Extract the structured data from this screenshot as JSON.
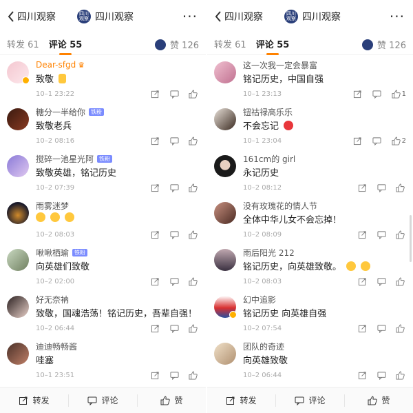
{
  "colors": {
    "accent": "#ff8200",
    "fan_badge": "#7b8cff",
    "meta_gray": "#aaaaaa",
    "emoji_yellow": "#ffc83d",
    "flower_red": "#e8363b"
  },
  "left": {
    "header": {
      "back_label": "四川观察",
      "account_name": "四川观察",
      "logo_text": "四川观察",
      "more_label": "···"
    },
    "tabs": {
      "repost": "转发 61",
      "comment": "评论 55",
      "like": "赞 126"
    },
    "comments": [
      {
        "user": "Dear-sfgd",
        "highlight": true,
        "crown": "♛",
        "text": "致敬",
        "emoji": "thumbs-up",
        "time": "10–1 23:22"
      },
      {
        "user": "糖分一半给你",
        "fan_badge": "铁粉",
        "text": "致敬老兵",
        "time": "10–2 08:16"
      },
      {
        "user": "搅碎一池星光阿",
        "fan_badge": "铁粉",
        "text": "致敬英雄，铭记历史",
        "time": "10–2 07:39"
      },
      {
        "user": "雨雾迷梦",
        "text": "",
        "emoji": "three-faces",
        "time": "10–2 08:03"
      },
      {
        "user": "啾啾栖瑜",
        "fan_badge": "铁粉",
        "text": "向英雄们致敬",
        "time": "10–2 02:00"
      },
      {
        "user": "好无奈衲",
        "text": "致敬，国魂浩荡！铭记历史，吾辈自强！",
        "time": "10–2 06:44"
      },
      {
        "user": "迪迪畅畅酱",
        "text": "哇塞",
        "time": "10–1 23:51"
      }
    ],
    "bottom": {
      "repost": "转发",
      "comment": "评论",
      "like": "赞"
    }
  },
  "right": {
    "header": {
      "back_label": "四川观察",
      "account_name": "四川观察",
      "logo_text": "四川观察",
      "more_label": "···"
    },
    "tabs": {
      "repost": "转发 61",
      "comment": "评论 55",
      "like": "赞 126"
    },
    "comments": [
      {
        "user": "这一次我一定会暴富",
        "text": "铭记历史，中国自强",
        "time": "10–1 23:13",
        "likes": "1"
      },
      {
        "user": "钮祜禄高乐乐",
        "text": "不会忘记",
        "emoji": "flower",
        "time": "10–1 23:04",
        "likes": "2"
      },
      {
        "user": "161cm的 girl",
        "text": "永记历史",
        "time": "10–2 08:12"
      },
      {
        "user": "没有玫瑰花的情人节",
        "text": "全体中华儿女不会忘掉！",
        "time": "10–2 08:09"
      },
      {
        "user": "雨后阳光 212",
        "text": "铭记历史，向英雄致敬。",
        "emoji": "two-faces",
        "time": "10–2 08:03"
      },
      {
        "user": "幻中追影",
        "text": "铭记历史 向英雄自强",
        "time": "10–2 07:54"
      },
      {
        "user": "团队的奇迹",
        "text": "向英雄致敬",
        "time": "10–2 06:44"
      }
    ],
    "bottom": {
      "repost": "转发",
      "comment": "评论",
      "like": "赞"
    }
  }
}
